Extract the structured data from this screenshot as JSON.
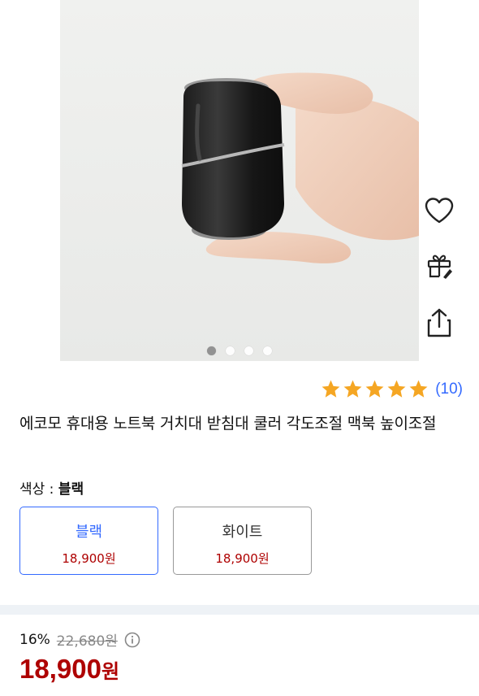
{
  "product_image": {
    "carousel": {
      "total": 4,
      "active_index": 0
    }
  },
  "side_actions": [
    {
      "icon": "heart-icon",
      "name": "wishlist-button"
    },
    {
      "icon": "gift-icon",
      "name": "gift-button"
    },
    {
      "icon": "share-icon",
      "name": "share-button"
    }
  ],
  "rating": {
    "stars": 5,
    "count_text": "(10)"
  },
  "title": "에코모 휴대용 노트북 거치대 받침대 쿨러 각도조절 맥북 높이조절",
  "option": {
    "label": "색상 : ",
    "selected": "블랙",
    "choices": [
      {
        "name": "블랙",
        "price": "18,900원"
      },
      {
        "name": "화이트",
        "price": "18,900원"
      }
    ]
  },
  "pricing": {
    "discount_rate": "16%",
    "original_price": "22,680원",
    "final_price": "18,900",
    "currency": "원"
  },
  "colors": {
    "accent_blue": "#346aff",
    "price_red": "#ae0000",
    "star": "#f5a623"
  }
}
